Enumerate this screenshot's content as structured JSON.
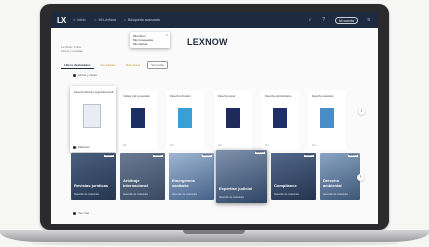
{
  "app": {
    "logo": "LX",
    "brand_title": "LEXNOW",
    "nav_items": [
      "Inicio",
      "Mi LexNow",
      "Búsqueda avanzada"
    ],
    "account_label": "Mi cuenta"
  },
  "dropdown": {
    "items": [
      "Mis libros",
      "Mis búsquedas",
      "Mis alertas"
    ]
  },
  "breadcrumb": [
    "LexNow / Inicio",
    "Libros y revistas"
  ],
  "tabs": [
    {
      "label": "Libros destacados",
      "style": "active"
    },
    {
      "label": "Novedades",
      "style": "yellow"
    },
    {
      "label": "Más leídos",
      "style": "yellow"
    },
    {
      "label": "Ver todos",
      "style": "outline"
    }
  ],
  "sections": {
    "books_label": "Libros y obras",
    "topics_label": "Materias",
    "footer_label": "Ver más"
  },
  "books": [
    {
      "title": "Derecho laboral y seguridad social",
      "footer": "Ver",
      "cover_color": "#e9edf3"
    },
    {
      "title": "Código civil comentado",
      "footer": "Ver",
      "cover_color": "#1c2f62"
    },
    {
      "title": "Derecho tributario",
      "footer": "Ver",
      "cover_color": "#3a9fd5"
    },
    {
      "title": "Derecho penal",
      "footer": "Ver",
      "cover_color": "#1e2a5e"
    },
    {
      "title": "Derecho administrativo",
      "footer": "Ver",
      "cover_color": "#1f2f6a"
    },
    {
      "title": "Derecho societario",
      "footer": "Ver",
      "cover_color": "#4a8cc6"
    }
  ],
  "topics": [
    {
      "title": "Revistas jurídicas",
      "subtitle": "Selección de contenidos",
      "badge": "NUEVO",
      "bg": "#31445f"
    },
    {
      "title": "Arbitraje internacional",
      "subtitle": "Selección de contenidos",
      "badge": "NUEVO",
      "bg": "#4a5a72"
    },
    {
      "title": "Emergencia sanitaria",
      "subtitle": "Selección de contenidos",
      "badge": "NUEVO",
      "bg": "#5f7ea4"
    },
    {
      "title": "Expertise judicial",
      "subtitle": "Selección de contenidos",
      "badge": "NUEVO",
      "bg": "#3b5274"
    },
    {
      "title": "Compliance",
      "subtitle": "Selección de contenidos",
      "badge": "NUEVO",
      "bg": "#2c3f5e"
    },
    {
      "title": "Derecho ambiental",
      "subtitle": "Selección de contenidos",
      "badge": "NUEVO",
      "bg": "#4c6a8e"
    }
  ]
}
